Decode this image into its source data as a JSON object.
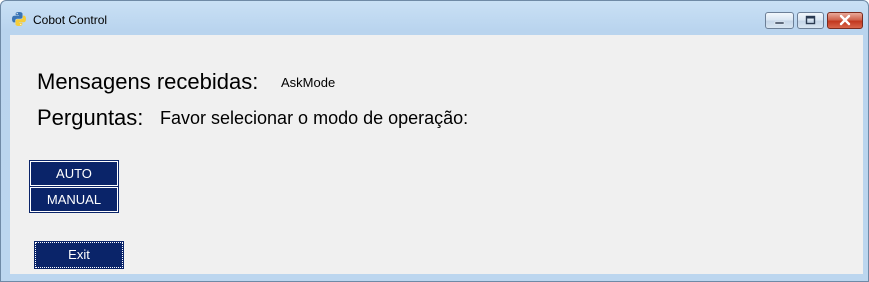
{
  "window": {
    "title": "Cobot Control"
  },
  "messages": {
    "label": "Mensagens recebidas:",
    "value": "AskMode"
  },
  "questions": {
    "label": "Perguntas:",
    "value": "Favor selecionar o modo de operação:"
  },
  "mode_buttons": {
    "auto_label": "AUTO",
    "manual_label": "MANUAL"
  },
  "exit_button": {
    "label": "Exit"
  },
  "colors": {
    "button_bg": "#0a2469",
    "client_bg": "#f0f0f0",
    "close_button": "#c2381f"
  }
}
